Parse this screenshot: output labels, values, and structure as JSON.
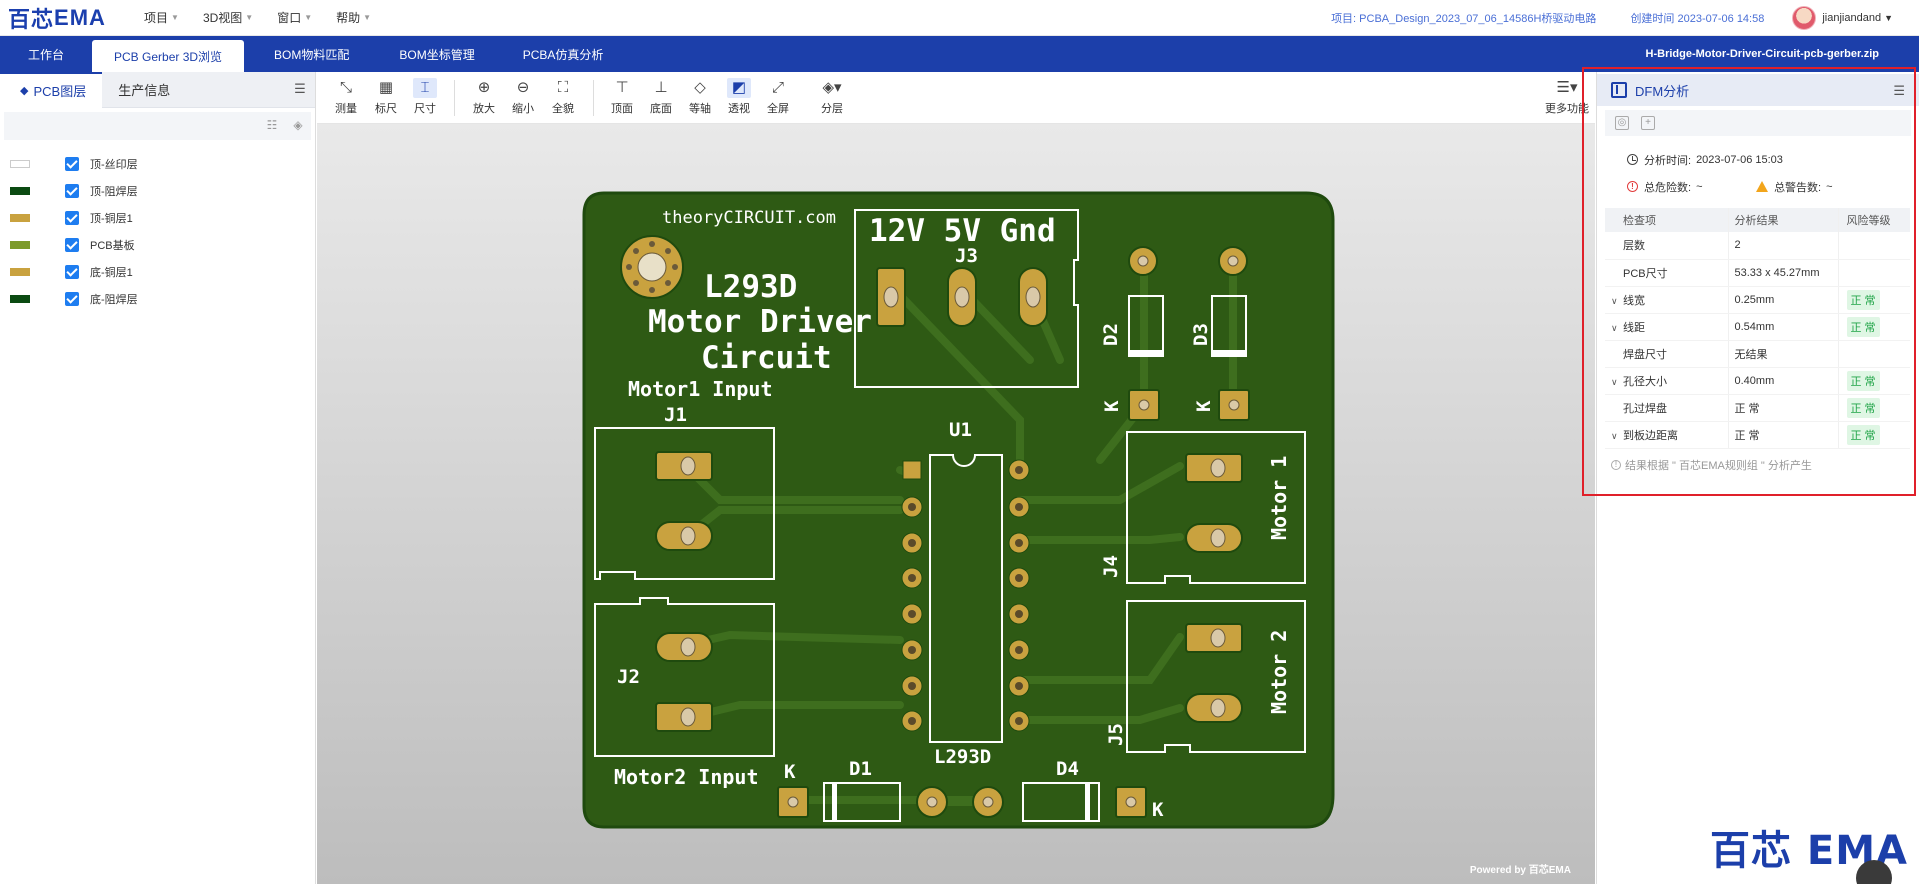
{
  "topbar": {
    "logo_mark": "百芯",
    "logo_text": "EMA",
    "menus": [
      {
        "label": "项目"
      },
      {
        "label": "3D视图"
      },
      {
        "label": "窗口"
      },
      {
        "label": "帮助"
      }
    ],
    "project": "项目: PCBA_Design_2023_07_06_14586H桥驱动电路",
    "created": "创建时间 2023-07-06 14:58",
    "username": "jianjiandand"
  },
  "tabs": [
    {
      "label": "工作台"
    },
    {
      "label": "PCB Gerber 3D浏览"
    },
    {
      "label": "BOM物料匹配"
    },
    {
      "label": "BOM坐标管理"
    },
    {
      "label": "PCBA仿真分析"
    }
  ],
  "active_tab": "PCB Gerber 3D浏览",
  "zip_name": "H-Bridge-Motor-Driver-Circuit-pcb-gerber.zip",
  "left_panel": {
    "tabs": [
      {
        "label": "PCB图层"
      },
      {
        "label": "生产信息"
      }
    ],
    "layers": [
      {
        "name": "顶-丝印层",
        "color": "#ffffff",
        "checked": true
      },
      {
        "name": "顶-阻焊层",
        "color": "#0b4a12",
        "checked": true
      },
      {
        "name": "顶-铜层1",
        "color": "#c9a23f",
        "checked": true
      },
      {
        "name": "PCB基板",
        "color": "#7c9a2a",
        "checked": true
      },
      {
        "name": "底-铜层1",
        "color": "#c9a23f",
        "checked": true
      },
      {
        "name": "底-阻焊层",
        "color": "#0b4a12",
        "checked": true
      }
    ]
  },
  "toolbar": {
    "measure": "测量",
    "ruler": "标尺",
    "dimension": "尺寸",
    "zoom_in": "放大",
    "zoom_out": "缩小",
    "fit": "全貌",
    "top": "顶面",
    "bottom": "底面",
    "axis": "等轴",
    "transparent": "透视",
    "fullscreen": "全屏",
    "layers": "分层",
    "more": "更多功能"
  },
  "board": {
    "silk_site": "theoryCIRCUIT.com",
    "silk_power": "12V 5V Gnd",
    "silk_j3": "J3",
    "silk_title1": "L293D",
    "silk_title2": "Motor Driver",
    "silk_title3": "Circuit",
    "silk_motor1_input": "Motor1 Input",
    "silk_j1": "J1",
    "silk_u1": "U1",
    "silk_l293d": "L293D",
    "silk_j2": "J2",
    "silk_motor2_input": "Motor2 Input",
    "silk_d1": "D1",
    "silk_d4": "D4",
    "silk_d2": "D2",
    "silk_d3": "D3",
    "silk_k": "K",
    "silk_j4": "J4",
    "silk_j5": "J5",
    "silk_motor1": "Motor 1",
    "silk_motor2": "Motor 2",
    "colors": {
      "mask": "#2e5a14",
      "copper": "#c9a23f",
      "silk": "#ffffff",
      "edge": "#1f4a0e"
    }
  },
  "powered_by": "Powered by 百芯EMA",
  "dfm": {
    "title": "DFM分析",
    "time_label": "分析时间:",
    "time_value": "2023-07-06 15:03",
    "danger_label": "总危险数:",
    "danger_value": "~",
    "warn_label": "总警告数:",
    "warn_value": "~",
    "headers": [
      "检查项",
      "分析结果",
      "风险等级"
    ],
    "rows": [
      {
        "item": "层数",
        "result": "2",
        "risk": "",
        "expandable": false
      },
      {
        "item": "PCB尺寸",
        "result": "53.33 x 45.27mm",
        "risk": "",
        "expandable": false
      },
      {
        "item": "线宽",
        "result": "0.25mm",
        "risk": "正 常",
        "expandable": true
      },
      {
        "item": "线距",
        "result": "0.54mm",
        "risk": "正 常",
        "expandable": true
      },
      {
        "item": "焊盘尺寸",
        "result": "无结果",
        "risk": "",
        "expandable": false
      },
      {
        "item": "孔径大小",
        "result": "0.40mm",
        "risk": "正 常",
        "expandable": true
      },
      {
        "item": "孔过焊盘",
        "result": "正 常",
        "risk": "正 常",
        "expandable": false
      },
      {
        "item": "到板边距离",
        "result": "正 常",
        "risk": "正 常",
        "expandable": true
      }
    ],
    "note": "结果根据 \" 百芯EMA规则组 \" 分析产生"
  },
  "brand_watermark": "百芯 EMA"
}
